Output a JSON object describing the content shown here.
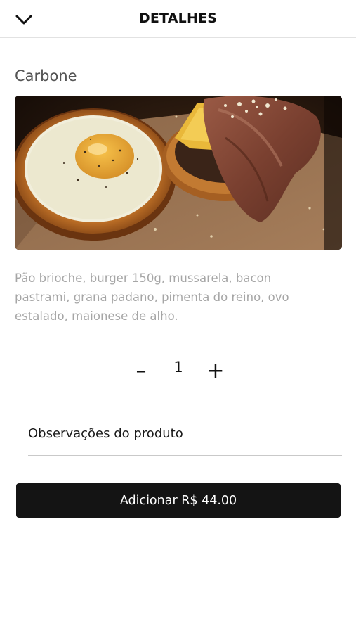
{
  "header": {
    "title": "DETALHES",
    "back_icon": "chevron-down-icon"
  },
  "product": {
    "name": "Carbone",
    "description": "Pão brioche, burger 150g, mussarela, bacon pastrami, grana padano, pimenta do reino, ovo estalado, maionese de alho.",
    "image_subject": "burger with fried egg, cheese and pastrami bacon"
  },
  "quantity": {
    "minus": "–",
    "value": "1",
    "plus": "+"
  },
  "notes": {
    "label": "Observações do produto"
  },
  "add_button": {
    "label": "Adicionar R$ 44.00"
  },
  "colors": {
    "button_bg": "#141414",
    "description_text": "#a6a6a6",
    "divider": "#e2e2e2"
  }
}
